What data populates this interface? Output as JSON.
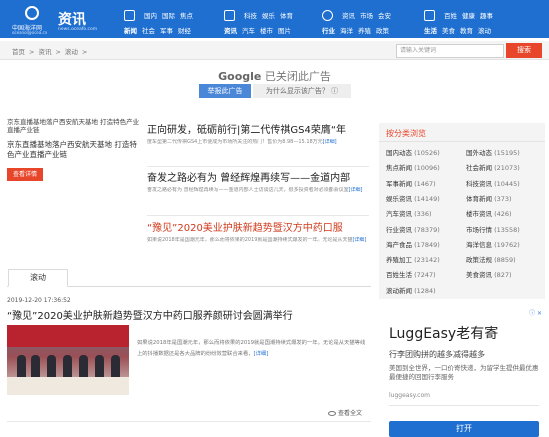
{
  "header": {
    "logo_text": "中国海洋网",
    "logo_sub": "oceanol@ocea.cn",
    "site_title": "资讯",
    "site_url": "news.oceafo.com",
    "nav1": {
      "row1": [
        "国内",
        "国际",
        "焦点"
      ],
      "row2": [
        "新闻",
        "社会",
        "军事",
        "财经"
      ]
    },
    "nav2": {
      "row1": [
        "科技",
        "娱乐",
        "体育"
      ],
      "row2": [
        "资讯",
        "汽车",
        "楼市",
        "图片"
      ]
    },
    "nav3": {
      "row1": [
        "资讯",
        "市场",
        "会安"
      ],
      "row2": [
        "行业",
        "海洋",
        "养殖",
        "政策"
      ]
    },
    "nav4": {
      "row1": [
        "百姓",
        "健康",
        "趣事"
      ],
      "row2": [
        "生活",
        "美食",
        "教育",
        "滚动"
      ]
    }
  },
  "breadcrumb": {
    "items": [
      "首页",
      ">",
      "资讯",
      ">",
      "滚动",
      ">"
    ]
  },
  "search": {
    "placeholder": "请输入关键词",
    "button": "搜索"
  },
  "ad_closed": {
    "prefix": "Google",
    "text": "已关闭此广告",
    "report_btn": "举报此广告",
    "why_btn": "为什么显示该广告？ ⓘ"
  },
  "feature": {
    "img_alt": "京东直播基地落户西安航天基地 打造特色产业直播产业链",
    "title": "京东直播基地落户西安航天基地 打造特色产业直播产业链",
    "button": "查看详情"
  },
  "news": [
    {
      "title": "正向研发，砥砺前行|第二代传祺GS4荣膺“年",
      "desc": "度车型第二代传祺GS4上市便成为市场所关注的热门！售价为8.98—15.18万元",
      "more": "[详细]"
    },
    {
      "title": "奋发之路必有为 曾经辉煌再续写——金道内部",
      "desc": "奋发之路必有为 曾经辉煌再续写——金道内部人士访谈这几天，很多投资者对必须都会议室",
      "more": "[详细]"
    },
    {
      "title": "“豫见”2020美业护肤新趋势暨汉方中药口服",
      "desc": "如果说2018年是国潮元年，那么而将依果的2019就是国潮持续式爆发的一年。无论是从天猫",
      "more": "[详细]"
    }
  ],
  "rank": {
    "title": "按分类浏览",
    "items": [
      {
        "name": "国内动态",
        "count": "(10526)"
      },
      {
        "name": "国外动态",
        "count": "(15195)"
      },
      {
        "name": "焦点新闻",
        "count": "(10096)"
      },
      {
        "name": "社会新闻",
        "count": "(21073)"
      },
      {
        "name": "军事新闻",
        "count": "(1467)"
      },
      {
        "name": "科技资讯",
        "count": "(10445)"
      },
      {
        "name": "娱乐资讯",
        "count": "(14149)"
      },
      {
        "name": "体育新闻",
        "count": "(373)"
      },
      {
        "name": "汽车资讯",
        "count": "(336)"
      },
      {
        "name": "楼市资讯",
        "count": "(426)"
      },
      {
        "name": "行业资讯",
        "count": "(78379)"
      },
      {
        "name": "市场行情",
        "count": "(13558)"
      },
      {
        "name": "海产食品",
        "count": "(17849)"
      },
      {
        "name": "海洋信息",
        "count": "(19762)"
      },
      {
        "name": "养殖加工",
        "count": "(23142)"
      },
      {
        "name": "政策法规",
        "count": "(8859)"
      },
      {
        "name": "百姓生活",
        "count": "(7247)"
      },
      {
        "name": "美食资讯",
        "count": "(827)"
      },
      {
        "name": "滚动新闻",
        "count": "(1284)"
      }
    ]
  },
  "scroll": {
    "tab": "滚动",
    "date": "2019-12-20 17:36:52",
    "title": "“豫见”2020美业护肤新趋势暨汉方中药口服养颜研讨会圆满举行",
    "desc": "如果说2018年是国潮元年，那么而将依果的2019就是国潮持续式爆发的一年。无论是从天猫等线上的抖播数据还是各大品牌的纷纷效营联合来看，",
    "more": "[详细]",
    "view_all": "查看全文"
  },
  "ad": {
    "badges": "ⓘ ✕",
    "title": "LuggEasy老有寄",
    "sub": "行李团购拼的越多减得越多",
    "body": "美国到全世界，一口价寄快递，为留学生提供最优惠最便捷的回国行李服务",
    "domain": "luggeasy.com",
    "button": "打开"
  },
  "colors": {
    "brand": "#1e6fd0",
    "accent": "#e8462b"
  }
}
